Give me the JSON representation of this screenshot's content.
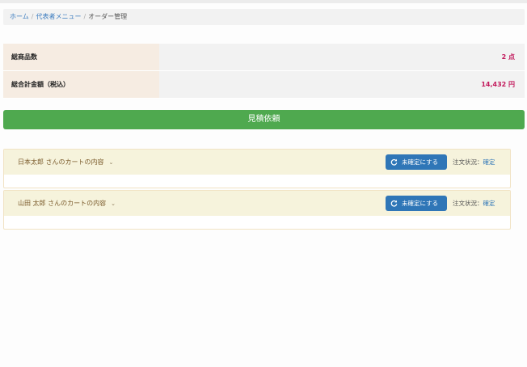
{
  "breadcrumb": {
    "home": "ホーム",
    "menu": "代表者メニュー",
    "separator": "/",
    "current": "オーダー管理"
  },
  "summary": {
    "rows": [
      {
        "label": "総商品数",
        "value": "2 点"
      },
      {
        "label": "総合計金額（税込）",
        "value": "14,432 円"
      }
    ]
  },
  "quote_button": {
    "label": "見積依頼"
  },
  "carts": [
    {
      "title": "日本太郎 さんのカートの内容",
      "button_label": "未確定にする",
      "status_label": "注文状況：",
      "status_value": "確定"
    },
    {
      "title": "山田 太郎 さんのカートの内容",
      "button_label": "未確定にする",
      "status_label": "注文状況：",
      "status_value": "確定"
    }
  ],
  "icons": {
    "dropdown": "chevron-down-icon",
    "refresh": "refresh-icon"
  },
  "colors": {
    "link": "#3a7bbf",
    "accent_value": "#c2185b",
    "quote_button": "#4fa94f",
    "action_button": "#2f76b7"
  }
}
